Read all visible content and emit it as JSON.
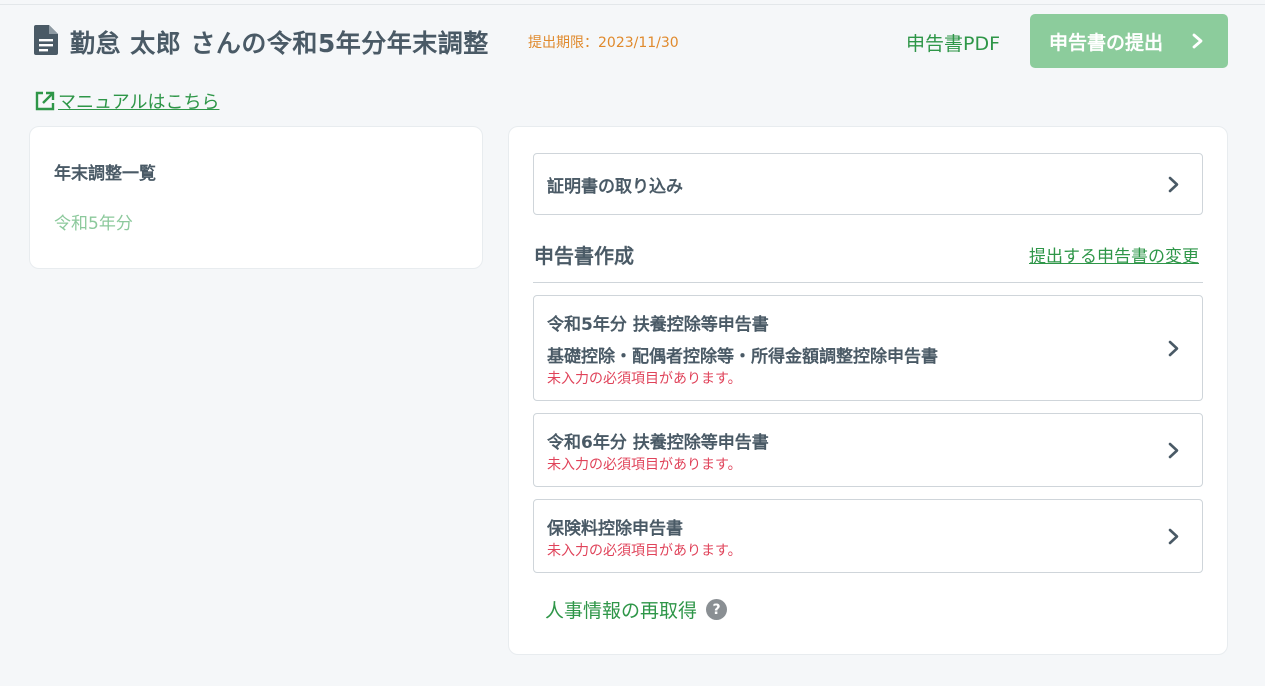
{
  "header": {
    "doc_icon": "document-icon",
    "title": "勤怠 太郎 さんの令和5年分年末調整",
    "deadline": "提出期限：2023/11/30",
    "pdf_label": "申告書PDF",
    "submit_label": "申告書の提出",
    "manual_icon": "external-link-icon",
    "manual_label": "マニュアルはこちら"
  },
  "sidebar": {
    "heading": "年末調整一覧",
    "items": [
      {
        "label": "令和5年分"
      }
    ]
  },
  "main": {
    "import_label": "証明書の取り込み",
    "section_title": "申告書作成",
    "change_label": "提出する申告書の変更",
    "forms": [
      {
        "title": "令和5年分 扶養控除等申告書",
        "subtitle": "基礎控除・配偶者控除等・所得金額調整控除申告書",
        "warning": "未入力の必須項目があります。"
      },
      {
        "title": "令和6年分 扶養控除等申告書",
        "warning": "未入力の必須項目があります。"
      },
      {
        "title": "保険料控除申告書",
        "warning": "未入力の必須項目があります。"
      }
    ],
    "refetch_label": "人事情報の再取得",
    "help_icon": "question-icon"
  },
  "colors": {
    "accent_green": "#2e9648",
    "submit_bg": "#8ccc9c",
    "deadline_orange": "#e08a2d",
    "warning_red": "#e0435a",
    "text_dark": "#4a5a66"
  }
}
